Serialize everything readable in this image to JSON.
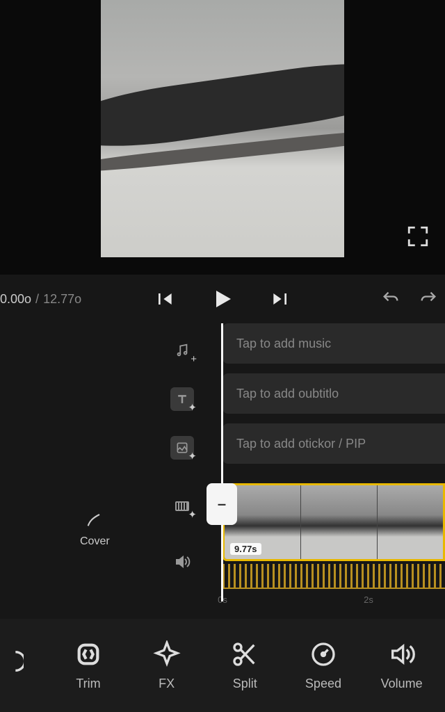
{
  "time": {
    "current": "0.00o",
    "sep": "/",
    "total": "12.77o"
  },
  "tracks": {
    "music_hint": "Tap to add music",
    "subtitle_hint": "Tap to add oubtitlo",
    "sticker_hint": "Tap to add otickor / PIP"
  },
  "clip": {
    "duration_label": "9.77s"
  },
  "ruler": {
    "t0": "0s",
    "t1": "2s"
  },
  "cover": {
    "label": "Cover"
  },
  "toolbar": {
    "unknown": "",
    "trim": "Trim",
    "fx": "FX",
    "split": "Split",
    "speed": "Speed",
    "volume": "Volume"
  },
  "icons": {
    "fullscreen": "expand-icon",
    "prev": "skip-previous-icon",
    "play": "play-icon",
    "next": "skip-next-icon",
    "undo": "undo-icon",
    "redo": "redo-icon",
    "music": "music-note-icon",
    "text": "text-icon",
    "sticker": "image-icon",
    "filmstrip": "filmstrip-icon",
    "audio": "speaker-icon",
    "pencil": "pencil-icon"
  }
}
